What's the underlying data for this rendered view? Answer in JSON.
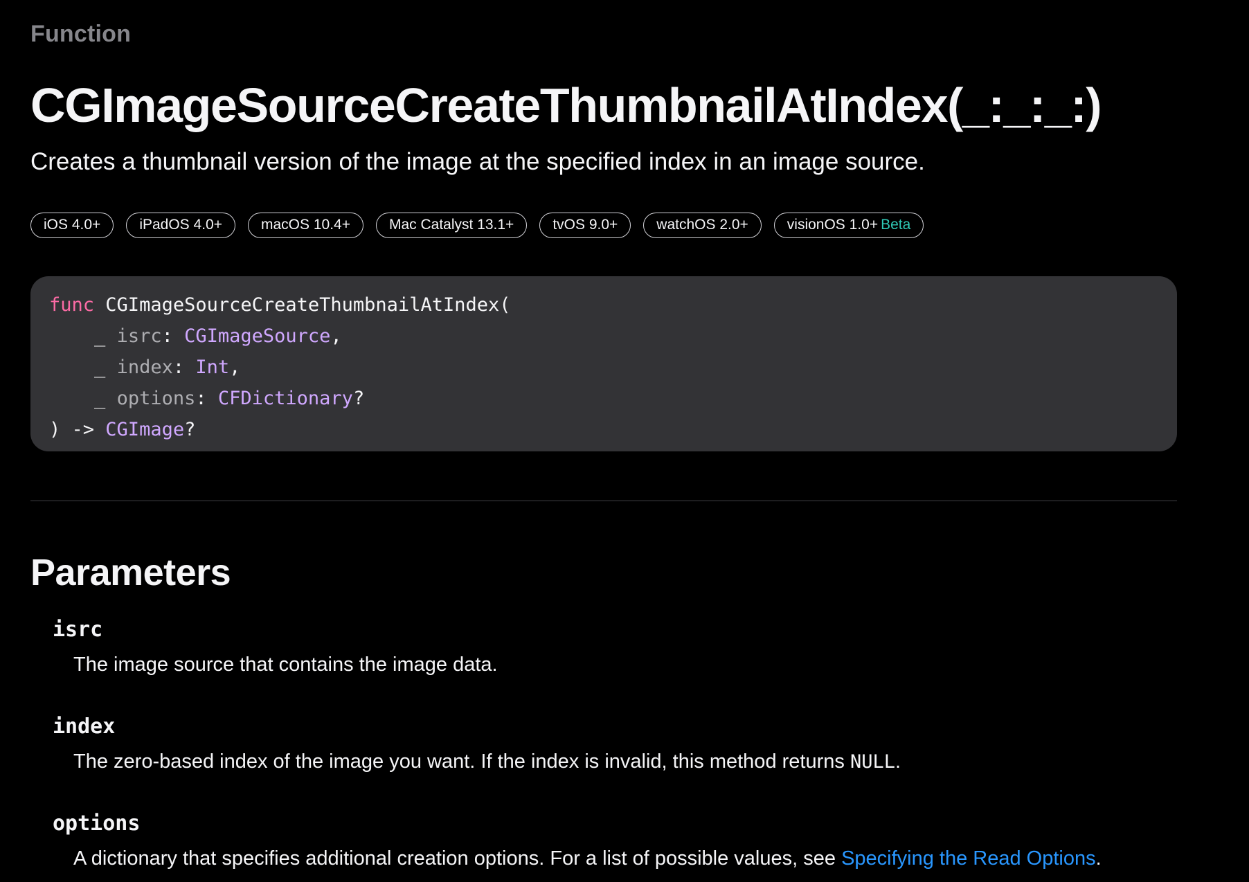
{
  "header": {
    "eyebrow": "Function",
    "title": "CGImageSourceCreateThumbnailAtIndex(_:_:_:)",
    "abstract": "Creates a thumbnail version of the image at the specified index in an image source."
  },
  "availability": [
    {
      "label": "iOS 4.0+"
    },
    {
      "label": "iPadOS 4.0+"
    },
    {
      "label": "macOS 10.4+"
    },
    {
      "label": "Mac Catalyst 13.1+"
    },
    {
      "label": "tvOS 9.0+"
    },
    {
      "label": "watchOS 2.0+"
    },
    {
      "label": "visionOS 1.0+",
      "tag": "Beta"
    }
  ],
  "declaration": {
    "keyword": "func",
    "name": "CGImageSourceCreateThumbnailAtIndex(",
    "params": [
      {
        "prefix": "_",
        "name": "isrc",
        "type": "CGImageSource",
        "suffix": ","
      },
      {
        "prefix": "_",
        "name": "index",
        "type": "Int",
        "suffix": ","
      },
      {
        "prefix": "_",
        "name": "options",
        "type": "CFDictionary",
        "suffix": "?"
      }
    ],
    "return_arrow": ") ->",
    "return_type": "CGImage",
    "return_suffix": "?"
  },
  "parameters_section": {
    "title": "Parameters",
    "items": [
      {
        "name": "isrc",
        "description": "The image source that contains the image data."
      },
      {
        "name": "index",
        "description_before": "The zero-based index of the image you want. If the index is invalid, this method returns ",
        "description_code": "NULL",
        "description_after": "."
      },
      {
        "name": "options",
        "description_before": "A dictionary that specifies additional creation options. For a list of possible values, see ",
        "link_text": "Specifying the Read Options",
        "description_after": "."
      }
    ]
  },
  "colors": {
    "background": "#000000",
    "text": "#f5f5f7",
    "secondary_text": "#86868b",
    "code_background": "#333336",
    "keyword": "#fc6ba5",
    "type": "#d0a8ff",
    "link": "#2997ff",
    "beta": "#2fc9b6"
  }
}
